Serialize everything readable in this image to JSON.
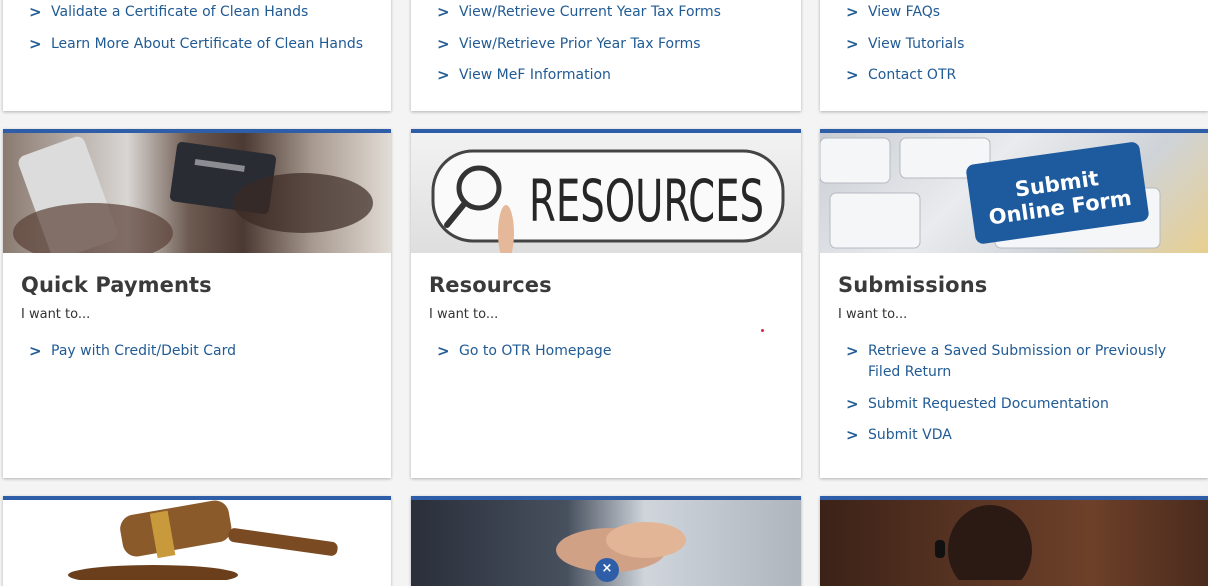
{
  "cards_top": [
    {
      "links": [
        "Validate a Certificate of Clean Hands",
        "Learn More About Certificate of Clean Hands"
      ]
    },
    {
      "links": [
        "View/Retrieve Current Year Tax Forms",
        "View/Retrieve Prior Year Tax Forms",
        "View MeF Information"
      ]
    },
    {
      "links": [
        "View FAQs",
        "View Tutorials",
        "Contact OTR"
      ]
    }
  ],
  "cards_middle": [
    {
      "title": "Quick Payments",
      "subtitle": "I want to...",
      "image": "credit-card-payment-photo",
      "links": [
        "Pay with Credit/Debit Card"
      ]
    },
    {
      "title": "Resources",
      "subtitle": "I want to...",
      "image": "resources-search-photo",
      "image_text": "RESOURCES",
      "links": [
        "Go to OTR Homepage"
      ]
    },
    {
      "title": "Submissions",
      "subtitle": "I want to...",
      "image": "submit-online-form-keyboard-photo",
      "image_text_1": "Submit",
      "image_text_2": "Online Form",
      "links": [
        "Retrieve a Saved Submission or Previously Filed Return",
        "Submit Requested Documentation",
        "Submit VDA"
      ]
    }
  ],
  "cards_bottom": [
    {
      "image": "gavel-photo"
    },
    {
      "image": "handshake-photo"
    },
    {
      "image": "person-headset-photo"
    }
  ],
  "chevron_glyph": ">",
  "close_glyph": "×",
  "accent_color": "#2f5ea8",
  "link_color": "#215b94"
}
